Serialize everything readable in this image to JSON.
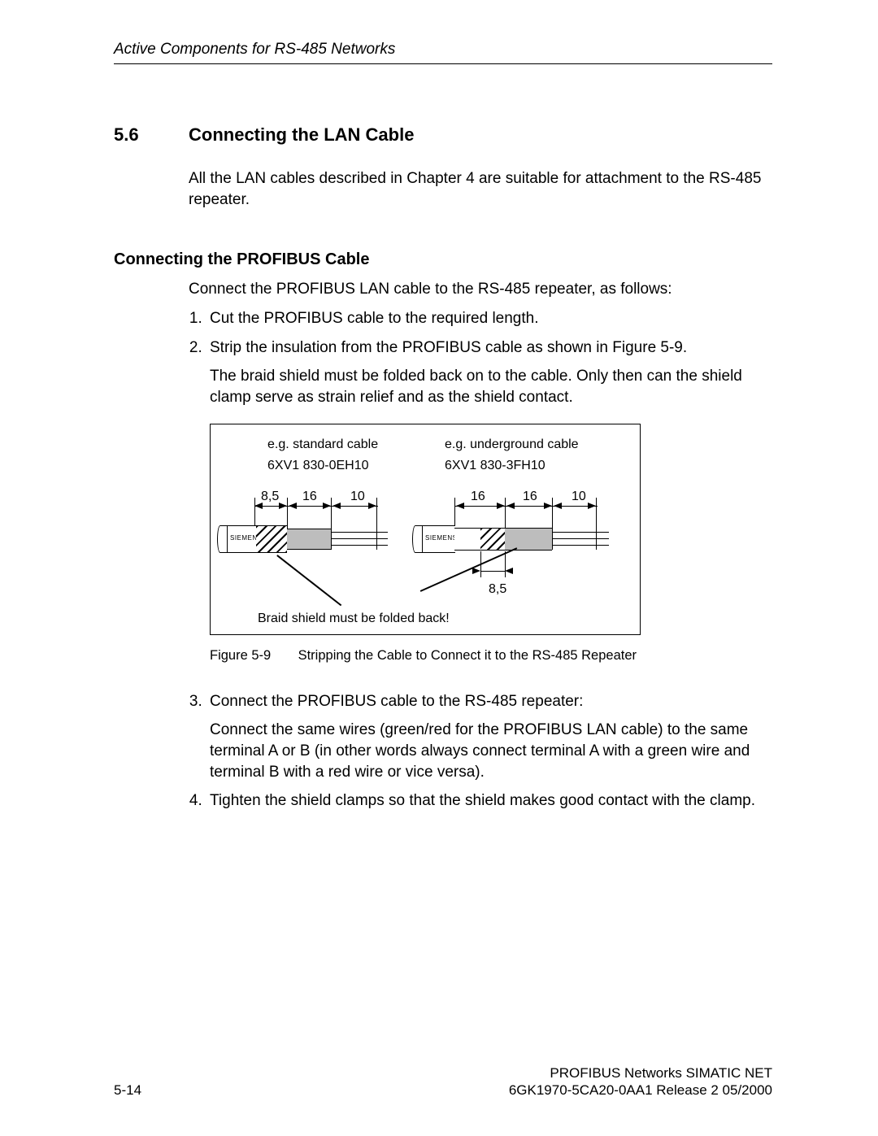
{
  "header": {
    "running_head": "Active Components for RS-485 Networks"
  },
  "section": {
    "number": "5.6",
    "title": "Connecting the LAN Cable",
    "intro": "All the LAN cables described in Chapter 4 are suitable for attachment to the RS-485 repeater."
  },
  "subsection": {
    "heading": "Connecting the PROFIBUS Cable",
    "lead": "Connect the PROFIBUS LAN cable to the RS-485 repeater, as follows:",
    "steps": {
      "s1": "Cut the PROFIBUS cable to the required length.",
      "s2": "Strip the insulation from the PROFIBUS cable as shown in Figure 5-9.",
      "s2_note": "The braid shield must be folded back on to the cable. Only then can the shield clamp serve as strain relief and as the shield contact.",
      "s3": "Connect the PROFIBUS cable to the RS-485 repeater:",
      "s3_note": "Connect the same wires (green/red for the PROFIBUS LAN cable) to the same terminal A or B (in other words always connect terminal A with a green wire and terminal B with a red wire or vice versa).",
      "s4": "Tighten the shield clamps so that the shield makes good contact with the clamp."
    }
  },
  "figure": {
    "left": {
      "title": "e.g. standard cable",
      "partno": "6XV1 830-0EH10",
      "dims": {
        "a": "8,5",
        "b": "16",
        "c": "10"
      },
      "brand": "SIEMENS"
    },
    "right": {
      "title": "e.g. underground cable",
      "partno": "6XV1 830-3FH10",
      "dims": {
        "a": "16",
        "b": "16",
        "c": "10",
        "under": "8,5"
      },
      "brand": "SIEMENS"
    },
    "note": "Braid shield must be folded back!",
    "caption_num": "Figure 5-9",
    "caption_text": "Stripping the Cable to Connect it to the RS-485 Repeater"
  },
  "footer": {
    "page": "5-14",
    "line1": "PROFIBUS Networks SIMATIC NET",
    "line2": "6GK1970-5CA20-0AA1 Release 2 05/2000"
  }
}
